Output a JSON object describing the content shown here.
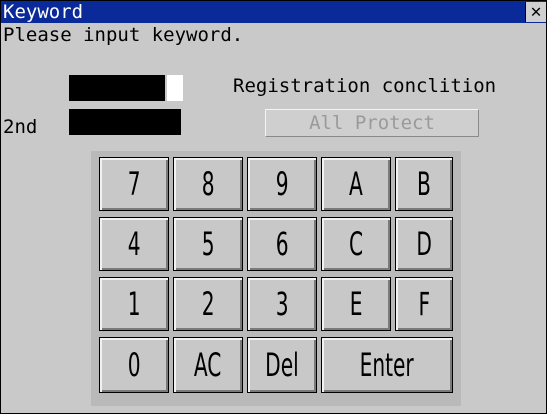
{
  "window": {
    "title": "Keyword",
    "close_glyph": "✕"
  },
  "prompt": "Please input keyword.",
  "registration_condition": "Registration conclition",
  "second_label": "2nd",
  "all_protect": "All Protect",
  "keypad": {
    "rows": [
      [
        "7",
        "8",
        "9",
        "A",
        "B"
      ],
      [
        "4",
        "5",
        "6",
        "C",
        "D"
      ],
      [
        "1",
        "2",
        "3",
        "E",
        "F"
      ],
      [
        "0",
        "AC",
        "Del",
        "Enter"
      ]
    ]
  }
}
